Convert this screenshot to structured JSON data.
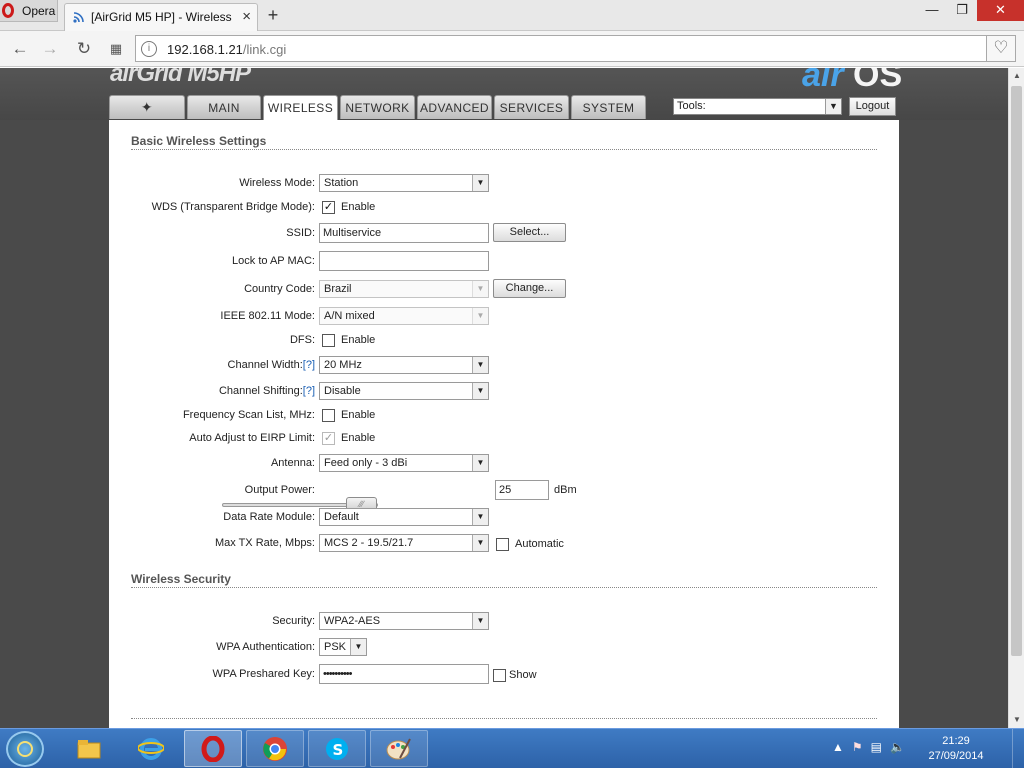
{
  "browser": {
    "menu_label": "Opera",
    "tab_title": "[AirGrid M5 HP] - Wireless",
    "tab_close": "×",
    "new_tab": "+",
    "url_host": "192.168.1.21",
    "url_path": "/link.cgi",
    "window_minimize": "—",
    "window_restore": "❐",
    "window_close": "✕"
  },
  "device": {
    "brand_left": "airGrid M5HP",
    "brand_right_air": "air",
    "brand_right_os": "OS"
  },
  "nav": {
    "tabs": [
      {
        "label": "✦"
      },
      {
        "label": "MAIN"
      },
      {
        "label": "WIRELESS"
      },
      {
        "label": "NETWORK"
      },
      {
        "label": "ADVANCED"
      },
      {
        "label": "SERVICES"
      },
      {
        "label": "SYSTEM"
      }
    ],
    "tools_value": "Tools:",
    "logout": "Logout"
  },
  "basic": {
    "title": "Basic Wireless Settings",
    "wireless_mode": {
      "label": "Wireless Mode:",
      "value": "Station"
    },
    "wds": {
      "label": "WDS (Transparent Bridge Mode):",
      "option": "Enable",
      "checked": true
    },
    "ssid": {
      "label": "SSID:",
      "value": "Multiservice",
      "button": "Select..."
    },
    "lock_ap_mac": {
      "label": "Lock to AP MAC:",
      "value": ""
    },
    "country_code": {
      "label": "Country Code:",
      "value": "Brazil",
      "button": "Change..."
    },
    "ieee_mode": {
      "label": "IEEE 802.11 Mode:",
      "value": "A/N mixed"
    },
    "dfs": {
      "label": "DFS:",
      "option": "Enable",
      "checked": false
    },
    "channel_width": {
      "label": "Channel Width:",
      "help": "[?]",
      "value": "20 MHz"
    },
    "channel_shifting": {
      "label": "Channel Shifting:",
      "help": "[?]",
      "value": "Disable"
    },
    "freq_scan_list": {
      "label": "Frequency Scan List, MHz:",
      "option": "Enable",
      "checked": false
    },
    "auto_eirp": {
      "label": "Auto Adjust to EIRP Limit:",
      "option": "Enable",
      "checked": true
    },
    "antenna": {
      "label": "Antenna:",
      "value": "Feed only - 3 dBi"
    },
    "output_power": {
      "label": "Output Power:",
      "value": "25",
      "unit": "dBm"
    },
    "data_rate_module": {
      "label": "Data Rate Module:",
      "value": "Default"
    },
    "max_tx_rate": {
      "label": "Max TX Rate, Mbps:",
      "value": "MCS 2 - 19.5/21.7",
      "option": "Automatic",
      "checked": false
    }
  },
  "security": {
    "title": "Wireless Security",
    "security": {
      "label": "Security:",
      "value": "WPA2-AES"
    },
    "wpa_auth": {
      "label": "WPA Authentication:",
      "value": "PSK"
    },
    "wpa_key": {
      "label": "WPA Preshared Key:",
      "value": "••••••••••",
      "option": "Show",
      "checked": false
    }
  },
  "taskbar": {
    "time": "21:29",
    "date": "27/09/2014"
  },
  "colors": {
    "accent_blue": "#4aa3e8",
    "opera_red": "#cc1a1a",
    "taskbar": "#2d62a8",
    "window_close": "#c7312b"
  }
}
